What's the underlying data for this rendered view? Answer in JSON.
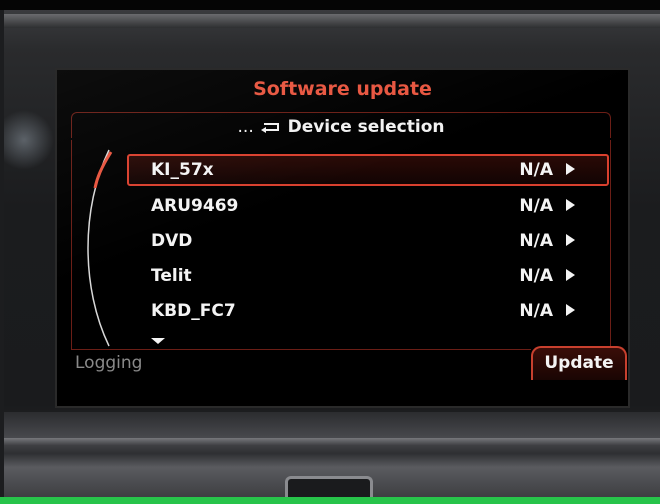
{
  "screen": {
    "title": "Software update",
    "breadcrumb_prefix": "...",
    "breadcrumb": "Device selection"
  },
  "devices": [
    {
      "name": "KI_57x",
      "status": "N/A",
      "selected": true
    },
    {
      "name": "ARU9469",
      "status": "N/A"
    },
    {
      "name": "DVD",
      "status": "N/A"
    },
    {
      "name": "Telit",
      "status": "N/A"
    },
    {
      "name": "KBD_FC7",
      "status": "N/A"
    }
  ],
  "footer": {
    "left_label": "Logging",
    "right_label": "Update"
  },
  "colors": {
    "title": "#e8553f",
    "accent_border": "#d9402e",
    "frame": "#6b1e16",
    "text": "#f4f4f4",
    "dim_text": "#8a8a8a"
  },
  "icons": {
    "back": "return-arrow-icon",
    "row_arrow": "triangle-right-icon",
    "more": "triangle-down-icon"
  }
}
